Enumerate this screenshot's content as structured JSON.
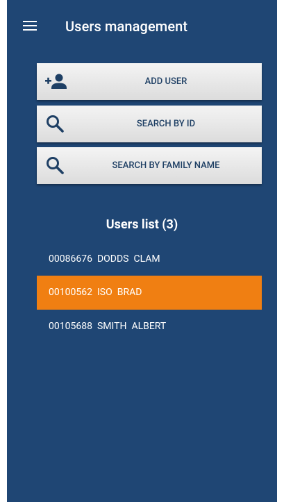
{
  "header": {
    "title": "Users management",
    "menu_icon": "hamburger-menu-icon"
  },
  "actions": {
    "add_user": {
      "label": "ADD USER",
      "icon": "person-add-icon"
    },
    "search_id": {
      "label": "SEARCH BY ID",
      "icon": "search-icon"
    },
    "search_family": {
      "label": "SEARCH BY FAMILY NAME",
      "icon": "search-icon"
    }
  },
  "list": {
    "title": "Users list (3)",
    "selected_color": "#f07f12",
    "users": [
      {
        "id": "00086676",
        "family": "DODDS",
        "given": "CLAM",
        "selected": false
      },
      {
        "id": "00100562",
        "family": "ISO",
        "given": "BRAD",
        "selected": true
      },
      {
        "id": "00105688",
        "family": "SMITH",
        "given": "ALBERT",
        "selected": false
      }
    ]
  },
  "colors": {
    "background": "#1f4674",
    "button_text": "#1e3f64",
    "selected_row": "#f07f12"
  }
}
